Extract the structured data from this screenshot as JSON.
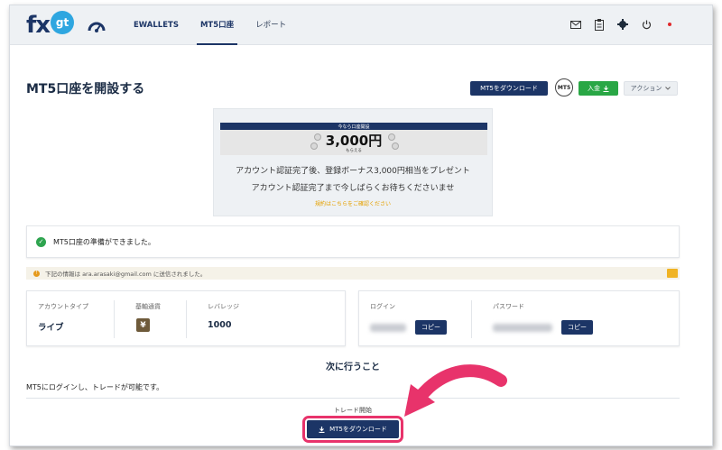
{
  "brand": {
    "logo_fx": "fx",
    "logo_gt": "gt"
  },
  "nav": {
    "items": [
      {
        "label": "EWALLETS"
      },
      {
        "label": "MT5口座"
      },
      {
        "label": "レポート"
      }
    ]
  },
  "header_icons": [
    "mail-icon",
    "clipboard-icon",
    "gear-icon",
    "power-icon",
    "flag-icon"
  ],
  "page": {
    "title": "MT5口座を開設する",
    "download_label": "MT5をダウンロード",
    "mt5_badge": "MT5",
    "deposit_label": "入金",
    "action_label": "アクション"
  },
  "promo": {
    "banner_top": "今なら口座開設",
    "amount": "3,000円",
    "amount_sub": "もらえる",
    "line1": "アカウント認証完了後、登録ボーナス3,000円相当をプレゼント",
    "line2": "アカウント認証完了まで今しばらくお待ちくださいませ",
    "link": "規約はこちらをご確認ください"
  },
  "alert": {
    "text": "MT5口座の準備ができました。"
  },
  "info": {
    "text": "下記の情報は ara.arasaki@gmail.com に送信されました。"
  },
  "account": {
    "type_label": "アカウントタイプ",
    "type_value": "ライブ",
    "currency_label": "基軸通貨",
    "currency_value": "¥",
    "leverage_label": "レバレッジ",
    "leverage_value": "1000",
    "login_label": "ログイン",
    "password_label": "パスワード",
    "copy_label": "コピー"
  },
  "next": {
    "title": "次に行うこと",
    "desc": "MT5にログインし、トレードが可能です。",
    "trade_start": "トレード開始",
    "download_label": "MT5をダウンロード"
  },
  "colors": {
    "primary": "#1c3566",
    "success": "#29a745",
    "highlight": "#e8336b",
    "warning": "#e59a1d"
  }
}
